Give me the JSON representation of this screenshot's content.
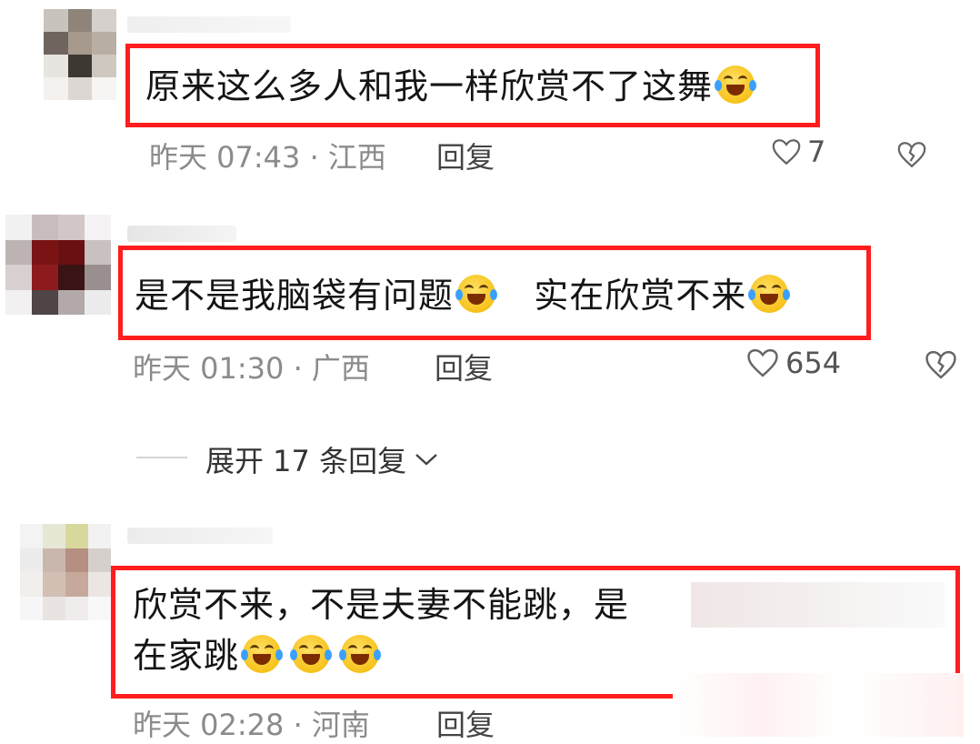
{
  "comments": [
    {
      "text": "原来这么多人和我一样欣赏不了这舞",
      "emojis": [
        "laughing-crying-face"
      ],
      "time": "昨天 07:43 · 江西",
      "reply_label": "回复",
      "likes": "7"
    },
    {
      "text_part1": "是不是我脑袋有问题",
      "text_part2": "实在欣赏不来",
      "emojis": [
        "laughing-crying-face",
        "laughing-crying-face"
      ],
      "time": "昨天 01:30 · 广西",
      "reply_label": "回复",
      "likes": "654"
    },
    {
      "text_line1": "欣赏不来，不是夫妻不能跳，是",
      "text_line2": "在家跳",
      "emojis": [
        "laughing-crying-face",
        "laughing-crying-face",
        "laughing-crying-face"
      ],
      "time": "昨天 02:28 · 河南",
      "reply_label": "回复"
    }
  ],
  "expand_replies": "展开 17 条回复",
  "colors": {
    "highlight": "#ff1d1d",
    "meta": "#8b8b8b",
    "emoji": "#f7c21a"
  },
  "icons": [
    "heart-outline-icon",
    "broken-heart-icon",
    "chevron-down-icon"
  ]
}
